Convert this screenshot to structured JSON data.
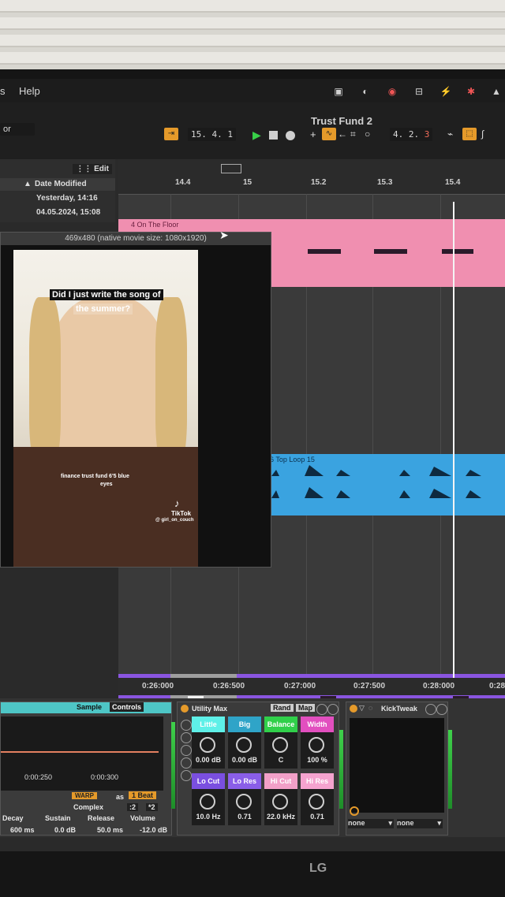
{
  "menu": {
    "item1": "s",
    "help": "Help"
  },
  "app": {
    "set_title": "Trust Fund 2",
    "left_selector": "or",
    "position": "15. 4. 1",
    "loop_length": "4. 2. 3",
    "loop_length_accent": "3"
  },
  "browser": {
    "edit_label": "Edit",
    "column_header": "Date Modified",
    "rows": [
      "Yesterday, 14:16",
      "04.05.2024, 15:08"
    ]
  },
  "arranger": {
    "ruler_labels": [
      "14.4",
      "15",
      "15.2",
      "15.3",
      "15.4"
    ],
    "pink_clip_name": "4 On The Floor",
    "blue_clip_name": "6 Top Loop 15",
    "purple_clip_name": "...",
    "time_labels": [
      "0:26:000",
      "0:26:500",
      "0:27:000",
      "0:27:500",
      "0:28:000",
      "0:28"
    ]
  },
  "video": {
    "title": "469x480 (native movie size: 1080x1920)",
    "caption_top_1": "Did I just write the song of",
    "caption_top_2": "the summer?",
    "caption_mid_1": "finance trust fund 6'5 blue",
    "caption_mid_2": "eyes",
    "tiktok_brand": "TikTok",
    "tiktok_handle": "@ girl_on_couch"
  },
  "sampler": {
    "tab_sample": "Sample",
    "tab_controls": "Controls",
    "time1": "0:00:250",
    "time2": "0:00:300",
    "warp": "WARP",
    "as": "as",
    "beat": "1 Beat",
    "mode": "Complex",
    "half": ":2",
    "double": "*2",
    "params": [
      {
        "label": "Decay",
        "value": "600 ms"
      },
      {
        "label": "Sustain",
        "value": "0.0 dB"
      },
      {
        "label": "Release",
        "value": "50.0 ms"
      },
      {
        "label": "Volume",
        "value": "-12.0 dB"
      }
    ]
  },
  "utility": {
    "name": "Utility Max",
    "rand": "Rand",
    "map": "Map",
    "cells": [
      {
        "label": "Little",
        "value": "0.00 dB",
        "color": "#5ef0e8"
      },
      {
        "label": "Big",
        "value": "0.00 dB",
        "color": "#2fa4c8"
      },
      {
        "label": "Balance",
        "value": "C",
        "color": "#30d04a"
      },
      {
        "label": "Width",
        "value": "100 %",
        "color": "#e24fbf"
      },
      {
        "label": "Lo Cut",
        "value": "10.0 Hz",
        "color": "#7a4fe0"
      },
      {
        "label": "Lo Res",
        "value": "0.71",
        "color": "#8a5ee8"
      },
      {
        "label": "Hi Cut",
        "value": "22.0 kHz",
        "color": "#f2a0c8"
      },
      {
        "label": "Hi Res",
        "value": "0.71",
        "color": "#f5a3cf"
      }
    ]
  },
  "kicktweak": {
    "name": "KickTweak",
    "sel1": "none",
    "sel2": "none"
  },
  "monitor": {
    "brand": "LG"
  },
  "colors": {
    "pink": "#f08fb0",
    "blue": "#3aa3e0",
    "purple": "#8a55e0",
    "orange": "#e59a2a"
  }
}
